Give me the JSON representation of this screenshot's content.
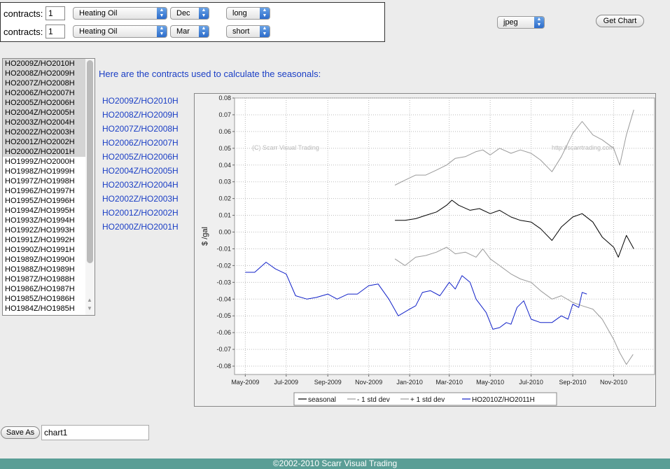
{
  "form": {
    "contracts_label": "contracts:",
    "rows": [
      {
        "qty": "1",
        "commodity": "Heating Oil",
        "month": "Dec",
        "side": "long"
      },
      {
        "qty": "1",
        "commodity": "Heating Oil",
        "month": "Mar",
        "side": "short"
      }
    ],
    "format": "jpeg",
    "get_chart_label": "Get Chart"
  },
  "contract_list": [
    "HO2009Z/HO2010H",
    "HO2008Z/HO2009H",
    "HO2007Z/HO2008H",
    "HO2006Z/HO2007H",
    "HO2005Z/HO2006H",
    "HO2004Z/HO2005H",
    "HO2003Z/HO2004H",
    "HO2002Z/HO2003H",
    "HO2001Z/HO2002H",
    "HO2000Z/HO2001H",
    "HO1999Z/HO2000H",
    "HO1998Z/HO1999H",
    "HO1997Z/HO1998H",
    "HO1996Z/HO1997H",
    "HO1995Z/HO1996H",
    "HO1994Z/HO1995H",
    "HO1993Z/HO1994H",
    "HO1992Z/HO1993H",
    "HO1991Z/HO1992H",
    "HO1990Z/HO1991H",
    "HO1989Z/HO1990H",
    "HO1988Z/HO1989H",
    "HO1987Z/HO1988H",
    "HO1986Z/HO1987H",
    "HO1985Z/HO1986H",
    "HO1984Z/HO1985H"
  ],
  "selected_count": 10,
  "heading": "Here are the contracts used to calculate the seasonals:",
  "used_contracts": [
    "HO2009Z/HO2010H",
    "HO2008Z/HO2009H",
    "HO2007Z/HO2008H",
    "HO2006Z/HO2007H",
    "HO2005Z/HO2006H",
    "HO2004Z/HO2005H",
    "HO2003Z/HO2004H",
    "HO2002Z/HO2003H",
    "HO2001Z/HO2002H",
    "HO2000Z/HO2001H"
  ],
  "save_as_label": "Save As",
  "filename": "chart1",
  "footer": "©2002-2010 Scarr Visual Trading",
  "chart_data": {
    "type": "line",
    "ylabel": "$ /gal",
    "ylim": [
      -0.085,
      0.08
    ],
    "yticks": [
      0.08,
      0.07,
      0.06,
      0.05,
      0.04,
      0.03,
      0.02,
      0.01,
      0.0,
      -0.01,
      -0.02,
      -0.03,
      -0.04,
      -0.05,
      -0.06,
      -0.07,
      -0.08
    ],
    "xlim": [
      "2009-04-15",
      "2011-01-01"
    ],
    "xticks": [
      {
        "date": "2009-05-01",
        "label": "May-2009"
      },
      {
        "date": "2009-07-01",
        "label": "Jul-2009"
      },
      {
        "date": "2009-09-01",
        "label": "Sep-2009"
      },
      {
        "date": "2009-11-01",
        "label": "Nov-2009"
      },
      {
        "date": "2010-01-01",
        "label": "Jan-2010"
      },
      {
        "date": "2010-03-01",
        "label": "Mar-2010"
      },
      {
        "date": "2010-05-01",
        "label": "May-2010"
      },
      {
        "date": "2010-07-01",
        "label": "Jul-2010"
      },
      {
        "date": "2010-09-01",
        "label": "Sep-2010"
      },
      {
        "date": "2010-11-01",
        "label": "Nov-2010"
      }
    ],
    "watermarks": [
      "(C) Scarr Visual Trading",
      "http://scarrtrading.com"
    ],
    "grid": true,
    "legend": "bottom",
    "series": [
      {
        "name": "seasonal",
        "color": "#000000",
        "points": [
          [
            "2009-12-10",
            0.007
          ],
          [
            "2009-12-25",
            0.007
          ],
          [
            "2010-01-10",
            0.008
          ],
          [
            "2010-01-25",
            0.01
          ],
          [
            "2010-02-10",
            0.012
          ],
          [
            "2010-02-25",
            0.016
          ],
          [
            "2010-03-05",
            0.019
          ],
          [
            "2010-03-15",
            0.016
          ],
          [
            "2010-04-01",
            0.013
          ],
          [
            "2010-04-15",
            0.014
          ],
          [
            "2010-05-01",
            0.011
          ],
          [
            "2010-05-15",
            0.013
          ],
          [
            "2010-06-01",
            0.009
          ],
          [
            "2010-06-15",
            0.007
          ],
          [
            "2010-07-01",
            0.006
          ],
          [
            "2010-07-15",
            0.002
          ],
          [
            "2010-08-01",
            -0.005
          ],
          [
            "2010-08-15",
            0.003
          ],
          [
            "2010-09-01",
            0.009
          ],
          [
            "2010-09-15",
            0.011
          ],
          [
            "2010-10-01",
            0.006
          ],
          [
            "2010-10-15",
            -0.003
          ],
          [
            "2010-11-01",
            -0.009
          ],
          [
            "2010-11-08",
            -0.015
          ],
          [
            "2010-11-20",
            -0.002
          ],
          [
            "2010-12-01",
            -0.01
          ]
        ]
      },
      {
        "name": "- 1 std dev",
        "color": "#9a9a9a",
        "points": [
          [
            "2009-12-10",
            -0.016
          ],
          [
            "2009-12-25",
            -0.02
          ],
          [
            "2010-01-10",
            -0.015
          ],
          [
            "2010-01-25",
            -0.014
          ],
          [
            "2010-02-10",
            -0.012
          ],
          [
            "2010-02-25",
            -0.009
          ],
          [
            "2010-03-10",
            -0.013
          ],
          [
            "2010-03-25",
            -0.012
          ],
          [
            "2010-04-10",
            -0.015
          ],
          [
            "2010-04-20",
            -0.01
          ],
          [
            "2010-05-01",
            -0.016
          ],
          [
            "2010-05-15",
            -0.02
          ],
          [
            "2010-06-01",
            -0.025
          ],
          [
            "2010-06-15",
            -0.028
          ],
          [
            "2010-07-01",
            -0.03
          ],
          [
            "2010-07-15",
            -0.035
          ],
          [
            "2010-08-01",
            -0.04
          ],
          [
            "2010-08-15",
            -0.038
          ],
          [
            "2010-09-01",
            -0.042
          ],
          [
            "2010-09-15",
            -0.044
          ],
          [
            "2010-10-01",
            -0.046
          ],
          [
            "2010-10-15",
            -0.052
          ],
          [
            "2010-11-01",
            -0.064
          ],
          [
            "2010-11-10",
            -0.072
          ],
          [
            "2010-11-20",
            -0.079
          ],
          [
            "2010-11-30",
            -0.073
          ]
        ]
      },
      {
        "name": "+ 1 std dev",
        "color": "#9a9a9a",
        "points": [
          [
            "2009-12-10",
            0.028
          ],
          [
            "2009-12-25",
            0.031
          ],
          [
            "2010-01-10",
            0.034
          ],
          [
            "2010-01-25",
            0.034
          ],
          [
            "2010-02-10",
            0.037
          ],
          [
            "2010-02-25",
            0.04
          ],
          [
            "2010-03-10",
            0.044
          ],
          [
            "2010-03-25",
            0.045
          ],
          [
            "2010-04-10",
            0.048
          ],
          [
            "2010-04-20",
            0.049
          ],
          [
            "2010-05-01",
            0.046
          ],
          [
            "2010-05-15",
            0.05
          ],
          [
            "2010-06-01",
            0.047
          ],
          [
            "2010-06-15",
            0.049
          ],
          [
            "2010-07-01",
            0.047
          ],
          [
            "2010-07-15",
            0.043
          ],
          [
            "2010-08-01",
            0.036
          ],
          [
            "2010-08-15",
            0.045
          ],
          [
            "2010-09-01",
            0.059
          ],
          [
            "2010-09-15",
            0.066
          ],
          [
            "2010-10-01",
            0.058
          ],
          [
            "2010-10-15",
            0.055
          ],
          [
            "2010-11-01",
            0.05
          ],
          [
            "2010-11-10",
            0.04
          ],
          [
            "2010-11-20",
            0.058
          ],
          [
            "2010-12-01",
            0.073
          ]
        ]
      },
      {
        "name": "HO2010Z/HO2011H",
        "color": "#1020c8",
        "points": [
          [
            "2009-05-01",
            -0.024
          ],
          [
            "2009-05-15",
            -0.024
          ],
          [
            "2009-06-01",
            -0.018
          ],
          [
            "2009-06-15",
            -0.022
          ],
          [
            "2009-07-01",
            -0.025
          ],
          [
            "2009-07-15",
            -0.038
          ],
          [
            "2009-08-01",
            -0.04
          ],
          [
            "2009-08-15",
            -0.039
          ],
          [
            "2009-09-01",
            -0.037
          ],
          [
            "2009-09-15",
            -0.04
          ],
          [
            "2009-10-01",
            -0.037
          ],
          [
            "2009-10-15",
            -0.037
          ],
          [
            "2009-11-01",
            -0.032
          ],
          [
            "2009-11-15",
            -0.031
          ],
          [
            "2009-12-01",
            -0.04
          ],
          [
            "2009-12-15",
            -0.05
          ],
          [
            "2010-01-01",
            -0.046
          ],
          [
            "2010-01-10",
            -0.044
          ],
          [
            "2010-01-20",
            -0.036
          ],
          [
            "2010-02-01",
            -0.035
          ],
          [
            "2010-02-15",
            -0.038
          ],
          [
            "2010-03-01",
            -0.03
          ],
          [
            "2010-03-10",
            -0.034
          ],
          [
            "2010-03-20",
            -0.026
          ],
          [
            "2010-04-01",
            -0.03
          ],
          [
            "2010-04-10",
            -0.04
          ],
          [
            "2010-04-25",
            -0.048
          ],
          [
            "2010-05-05",
            -0.058
          ],
          [
            "2010-05-15",
            -0.057
          ],
          [
            "2010-05-25",
            -0.054
          ],
          [
            "2010-06-01",
            -0.055
          ],
          [
            "2010-06-10",
            -0.045
          ],
          [
            "2010-06-20",
            -0.041
          ],
          [
            "2010-07-01",
            -0.052
          ],
          [
            "2010-07-15",
            -0.054
          ],
          [
            "2010-08-01",
            -0.054
          ],
          [
            "2010-08-15",
            -0.05
          ],
          [
            "2010-08-25",
            -0.052
          ],
          [
            "2010-09-01",
            -0.043
          ],
          [
            "2010-09-10",
            -0.045
          ],
          [
            "2010-09-15",
            -0.036
          ],
          [
            "2010-09-22",
            -0.037
          ]
        ]
      }
    ]
  }
}
